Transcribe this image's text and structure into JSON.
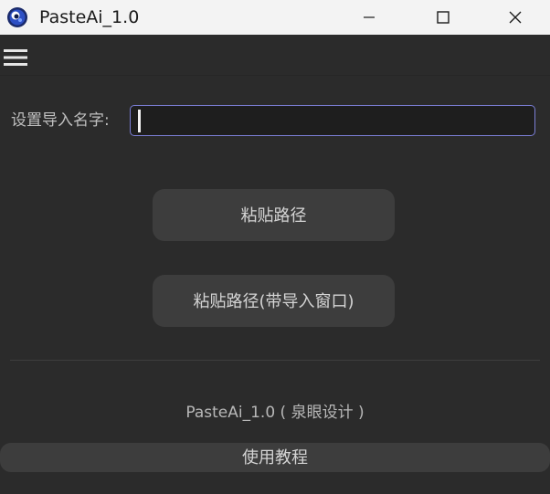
{
  "window": {
    "title": "PasteAi_1.0",
    "controls": {
      "minimize": "minimize",
      "maximize": "maximize",
      "close": "close"
    }
  },
  "menu": {
    "icon": "hamburger-menu-icon"
  },
  "form": {
    "name_label": "设置导入名字:",
    "name_value": ""
  },
  "actions": {
    "paste_path": "粘贴路径",
    "paste_path_with_window": "粘贴路径(带导入窗口)"
  },
  "footer": {
    "credit": "PasteAi_1.0 ( 泉眼设计 )",
    "tutorial": "使用教程"
  },
  "colors": {
    "background": "#2b2b2b",
    "titlebar": "#f3f3f3",
    "button": "#3d3d3d",
    "input_border": "#7b7fd6"
  }
}
